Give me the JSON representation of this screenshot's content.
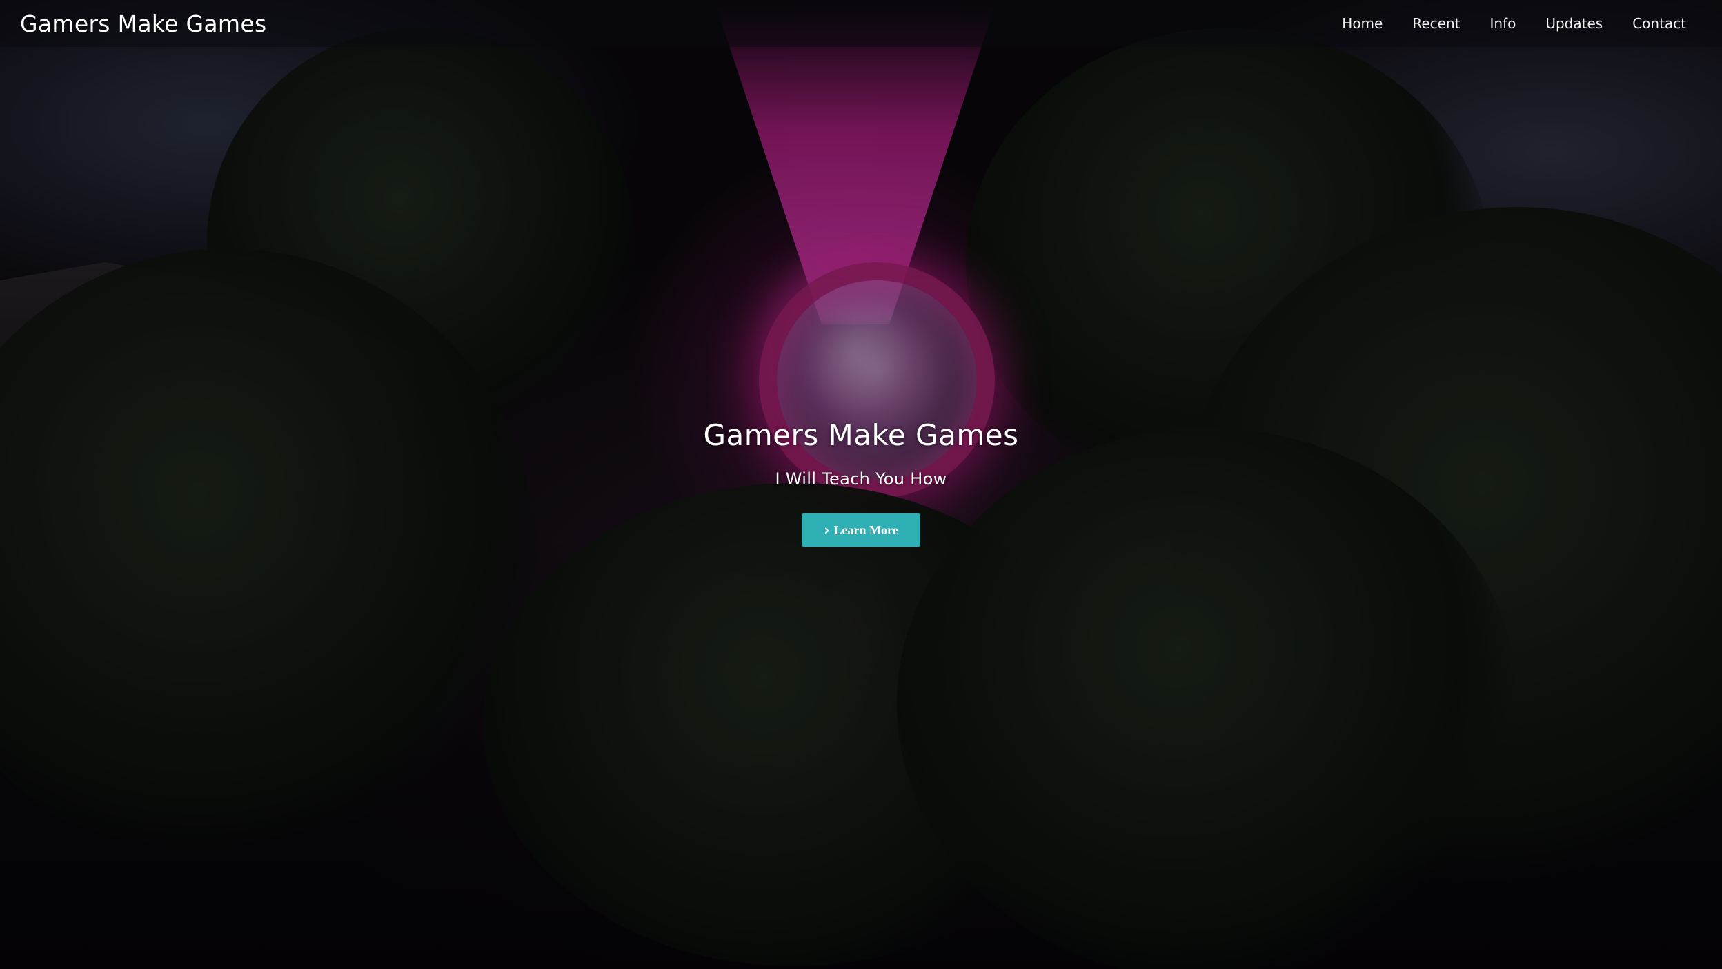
{
  "navbar": {
    "brand": "Gamers Make Games",
    "links": [
      {
        "label": "Home"
      },
      {
        "label": "Recent"
      },
      {
        "label": "Info"
      },
      {
        "label": "Updates"
      },
      {
        "label": "Contact"
      }
    ]
  },
  "hero": {
    "title": "Gamers Make Games",
    "subtitle": "I Will Teach You How",
    "cta": {
      "icon": "chevron-right-icon",
      "label": "Learn More"
    },
    "background": "forest-portal-scene"
  },
  "colors": {
    "accent": "#2fb0b5",
    "navbar_bg": "#0a0a0e",
    "text": "#ffffff",
    "portal_glow": "#d61e9c"
  }
}
